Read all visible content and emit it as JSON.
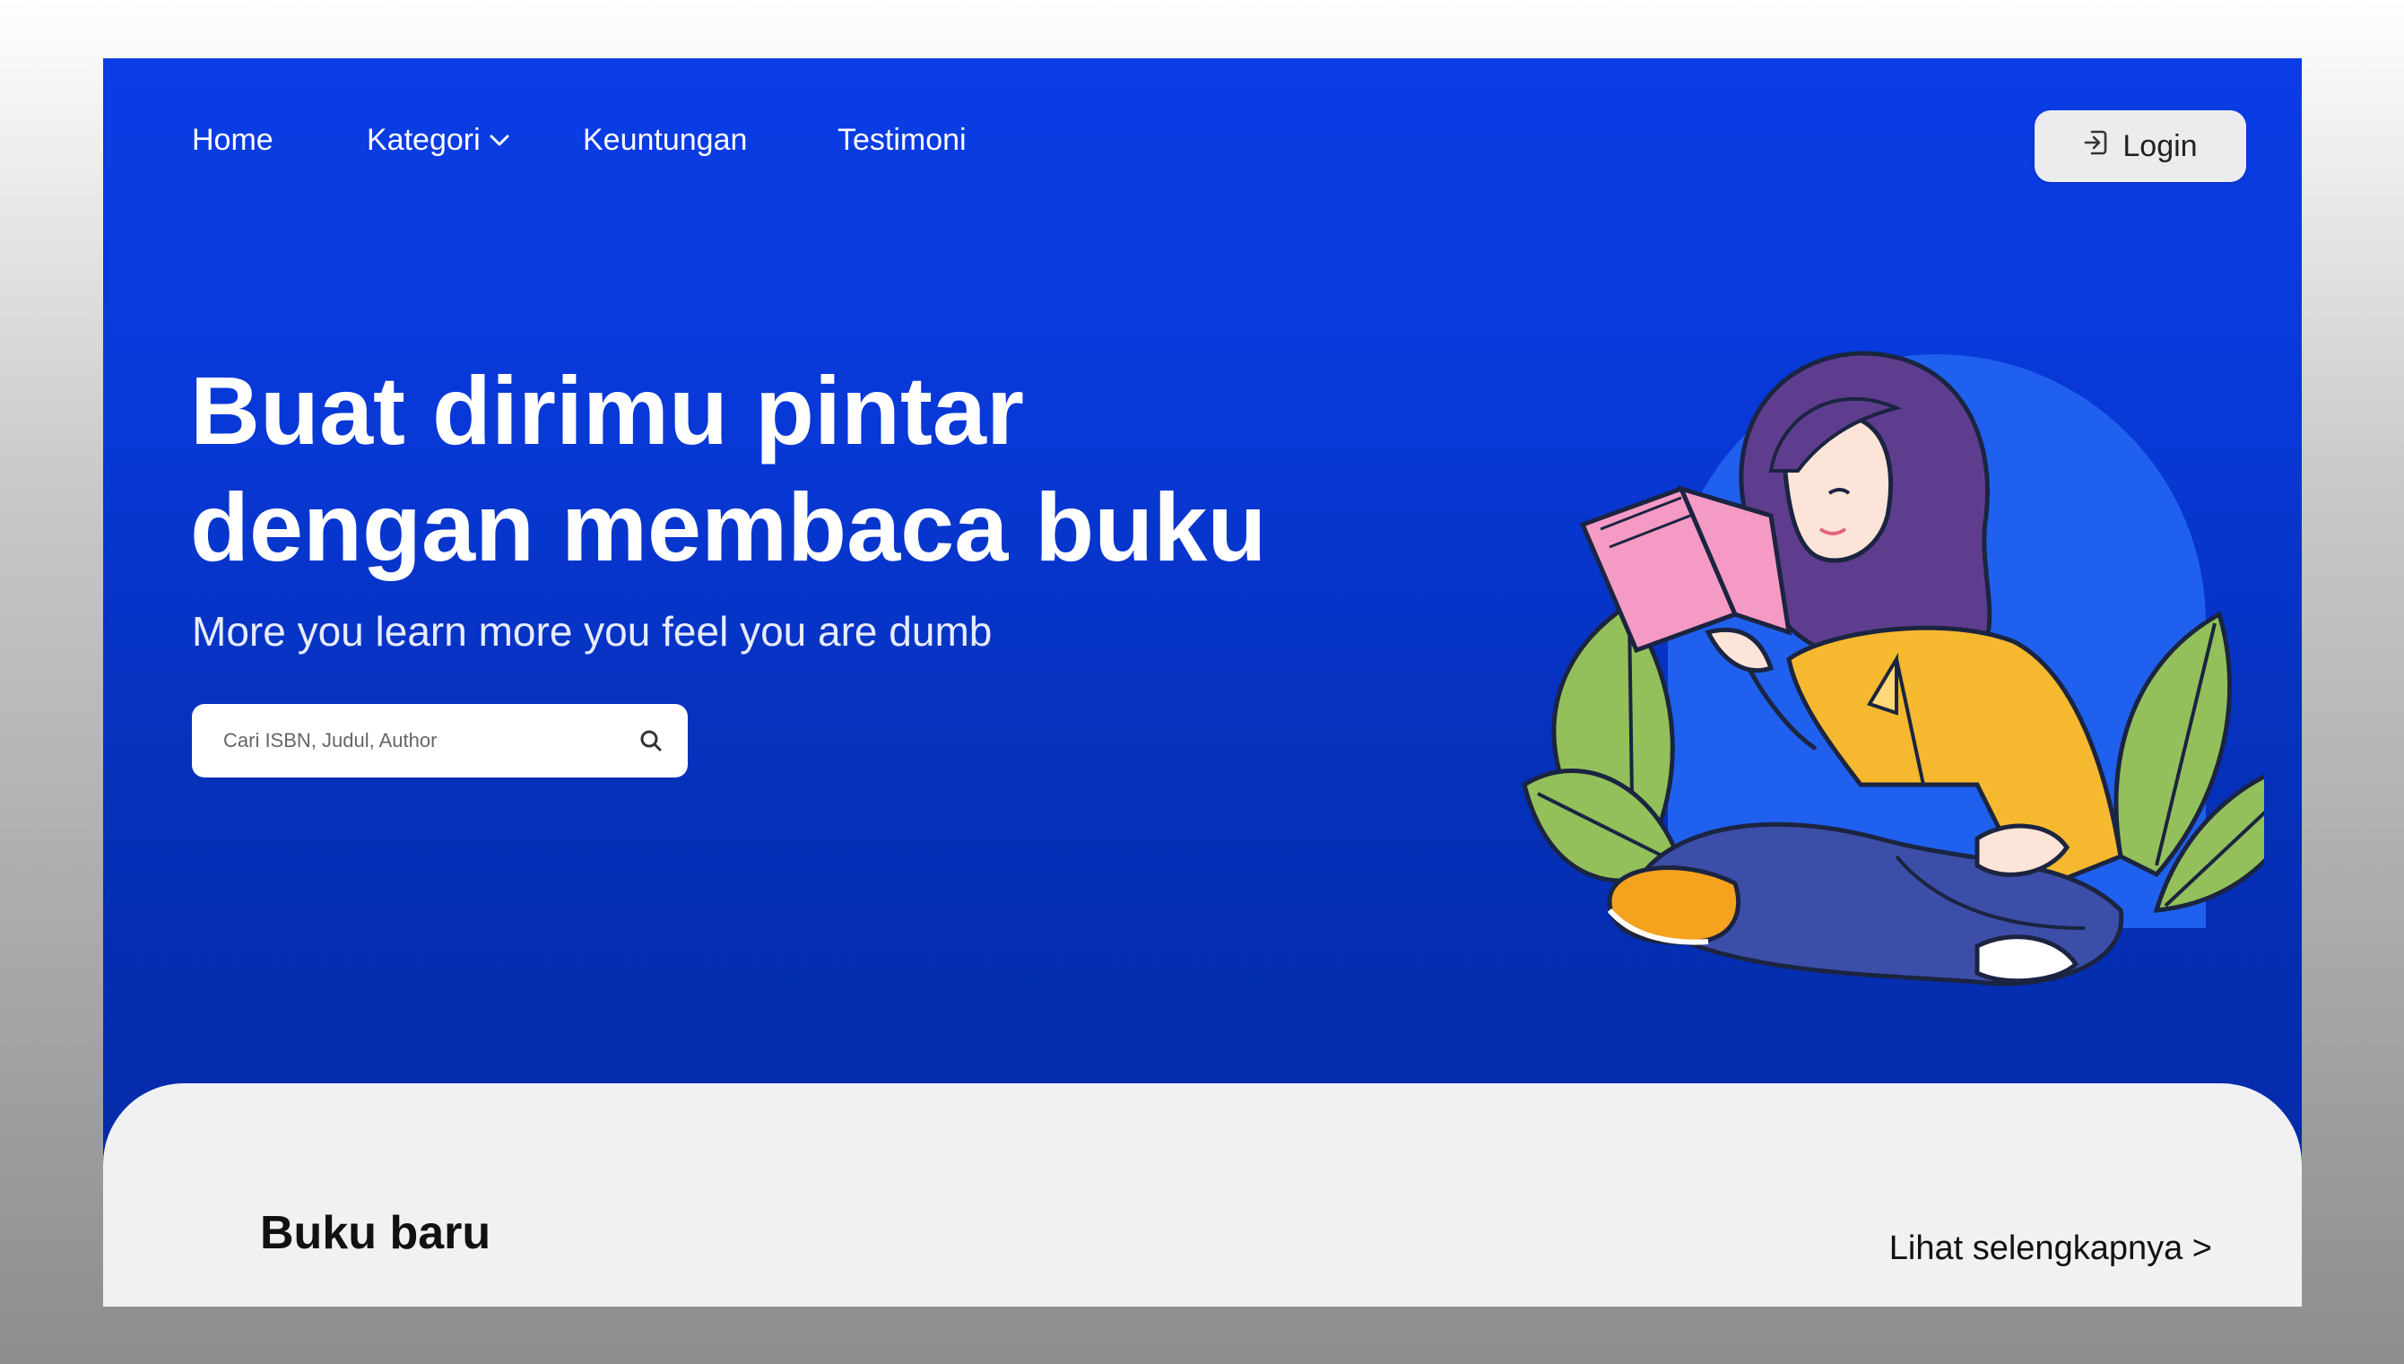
{
  "nav": {
    "items": [
      {
        "label": "Home"
      },
      {
        "label": "Kategori"
      },
      {
        "label": "Keuntungan"
      },
      {
        "label": "Testimoni"
      }
    ],
    "login_label": "Login"
  },
  "hero": {
    "title_line1": "Buat dirimu pintar",
    "title_line2": "dengan membaca buku",
    "subtitle": "More you learn more you feel you are dumb",
    "search_placeholder": "Cari ISBN, Judul, Author"
  },
  "section": {
    "title": "Buku baru",
    "see_more": "Lihat selengkapnya >"
  },
  "colors": {
    "hero_blue": "#0a3de6",
    "panel_bg": "#f1f1f3",
    "accent_yellow": "#f5b82e",
    "book_pink": "#f59ac4",
    "leaf_green": "#93c05a"
  },
  "icons": [
    "chevron-down-icon",
    "login-icon",
    "search-icon"
  ]
}
